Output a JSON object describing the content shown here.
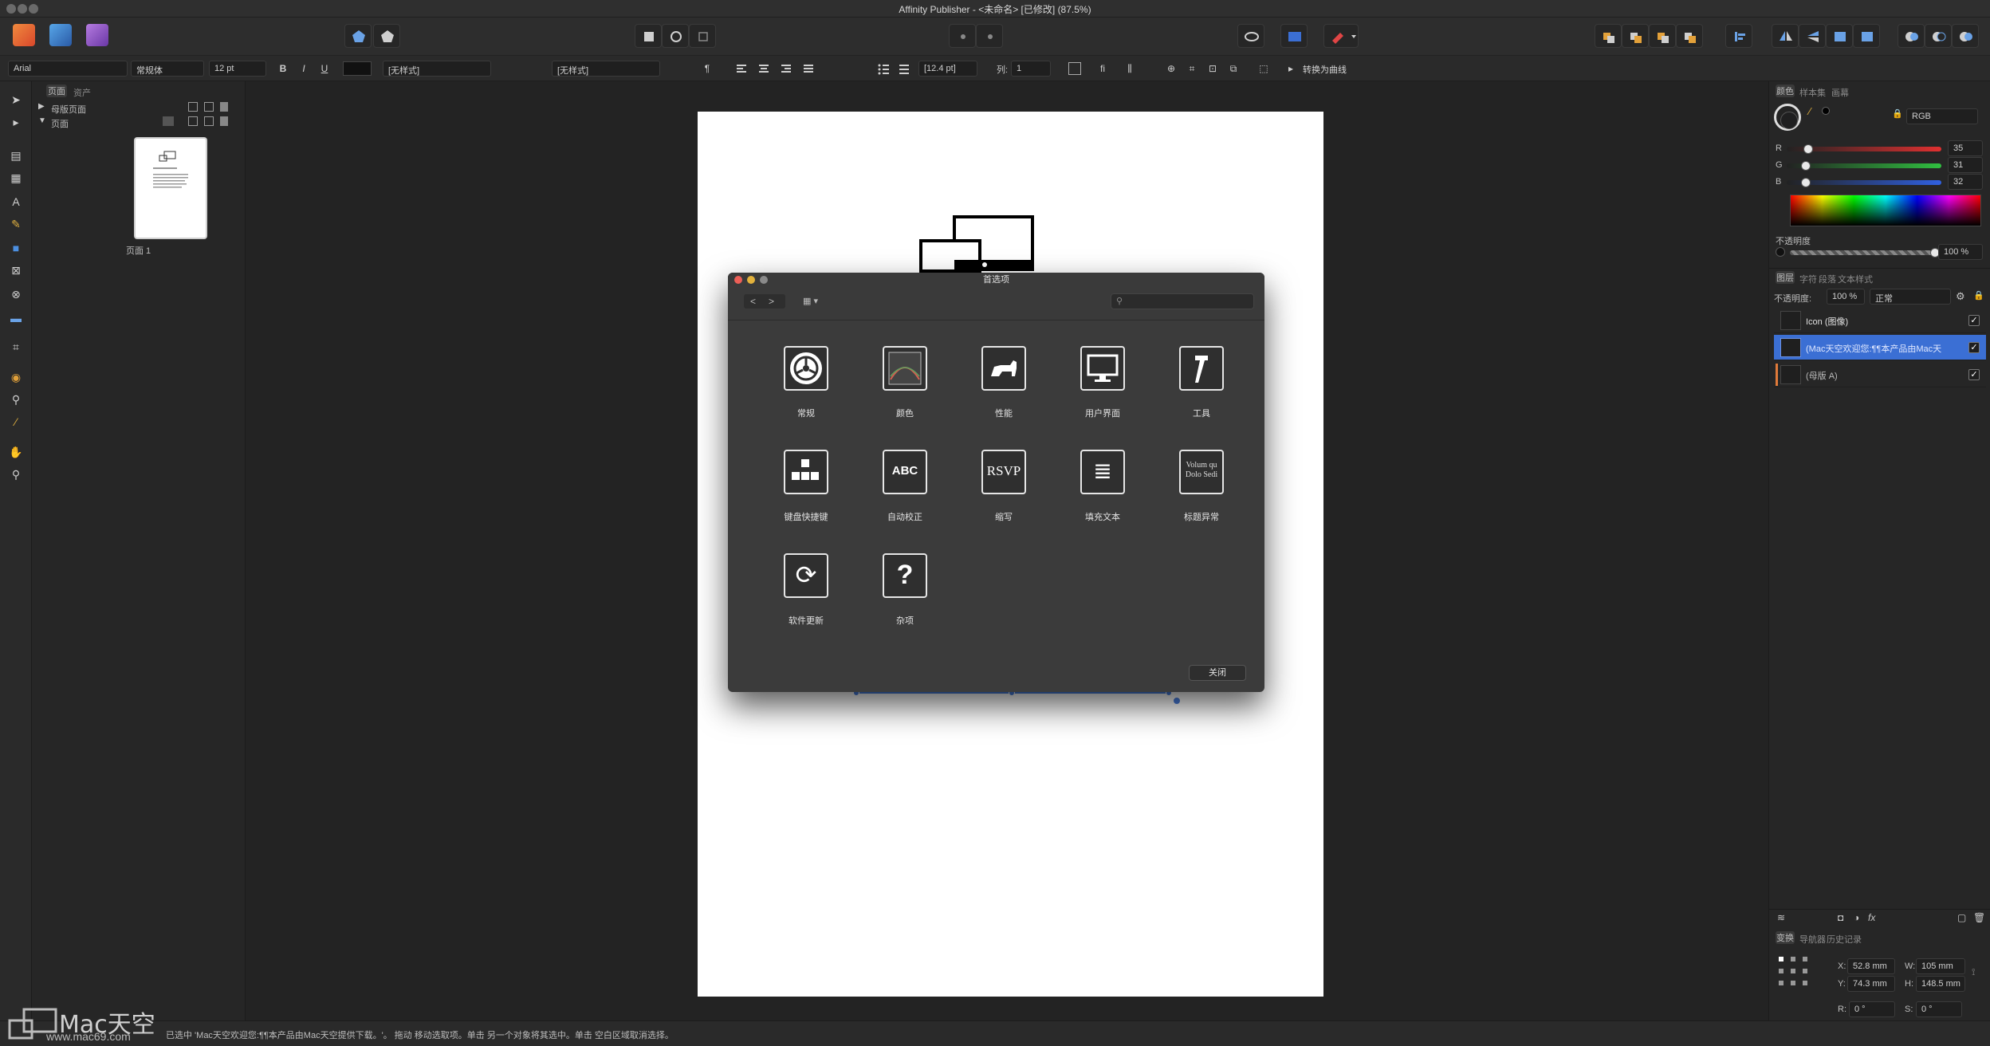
{
  "app": {
    "window_title": "Affinity Publisher - <未命名> [已修改] (87.5%)"
  },
  "context_toolbar": {
    "font_family": "Arial",
    "font_style": "常规体",
    "font_size": "12 pt",
    "bold": "B",
    "italic": "I",
    "underline": "U",
    "char_style": "[无样式]",
    "para_style": "[无样式]",
    "leading": "[12.4 pt]",
    "columns_label": "列:",
    "columns_value": "1",
    "convert_to_curves": "转换为曲线"
  },
  "pages_panel": {
    "tabs": [
      "页面",
      "资产"
    ],
    "master_pages_label": "母版页面",
    "pages_label": "页面",
    "page1_label": "页面 1"
  },
  "dialog": {
    "title": "首选项",
    "items": [
      {
        "label": "常规",
        "icon": "gear-icon"
      },
      {
        "label": "颜色",
        "icon": "color-icon"
      },
      {
        "label": "性能",
        "icon": "cat-icon"
      },
      {
        "label": "用户界面",
        "icon": "monitor-icon"
      },
      {
        "label": "工具",
        "icon": "hammer-icon"
      },
      {
        "label": "键盘快捷键",
        "icon": "keyboard-icon",
        "glyph": "⌨"
      },
      {
        "label": "自动校正",
        "icon": "abc-icon",
        "glyph": "ABC"
      },
      {
        "label": "缩写",
        "icon": "rsvp-icon",
        "glyph": "RSVP"
      },
      {
        "label": "填充文本",
        "icon": "filler-text-icon",
        "glyph": "≣"
      },
      {
        "label": "标题异常",
        "icon": "title-case-icon",
        "glyph": "Volum qu Dolo Sedi"
      },
      {
        "label": "软件更新",
        "icon": "update-icon",
        "glyph": "⟳"
      },
      {
        "label": "杂项",
        "icon": "question-icon",
        "glyph": "?"
      }
    ],
    "close_button": "关闭"
  },
  "color_panel": {
    "tabs": [
      "颜色",
      "样本集",
      "画幕"
    ],
    "model": "RGB",
    "r_label": "R",
    "r_value": "35",
    "r_fraction": 0.137,
    "g_label": "G",
    "g_value": "31",
    "g_fraction": 0.122,
    "b_label": "B",
    "b_value": "32",
    "b_fraction": 0.125,
    "opacity_label": "不透明度",
    "opacity_value": "100 %"
  },
  "layers_panel": {
    "tabs": [
      "图层",
      "字符",
      "段落",
      "文本样式"
    ],
    "opacity_label": "不透明度:",
    "opacity_value": "100 %",
    "blend_mode": "正常",
    "rows": [
      {
        "label": "Icon (图像)",
        "checked": "✓"
      },
      {
        "label": "(Mac天空欢迎您:¶¶本产品由Mac天",
        "checked": "✓"
      },
      {
        "label": "(母版 A)",
        "checked": "✓"
      }
    ]
  },
  "transform_panel": {
    "tabs": [
      "变换",
      "导航器",
      "历史记录"
    ],
    "x_label": "X:",
    "x_value": "52.8 mm",
    "y_label": "Y:",
    "y_value": "74.3 mm",
    "w_label": "W:",
    "w_value": "105 mm",
    "h_label": "H:",
    "h_value": "148.5 mm",
    "r_label": "R:",
    "r_value": "0 °",
    "s_label": "S:",
    "s_value": "0 °"
  },
  "status_bar": {
    "text": "已选中 'Mac天空欢迎您:¶¶本产品由Mac天空提供下载。'。 拖动 移动选取项。单击 另一个对象将其选中。单击 空白区域取消选择。"
  },
  "watermark": {
    "brand": "Mac天空",
    "url": "www.mac69.com"
  },
  "colors": {
    "accent": "#3b6fd4",
    "selection_frame": "#4a7fe0",
    "dialog_bg": "#3b3b3b"
  }
}
